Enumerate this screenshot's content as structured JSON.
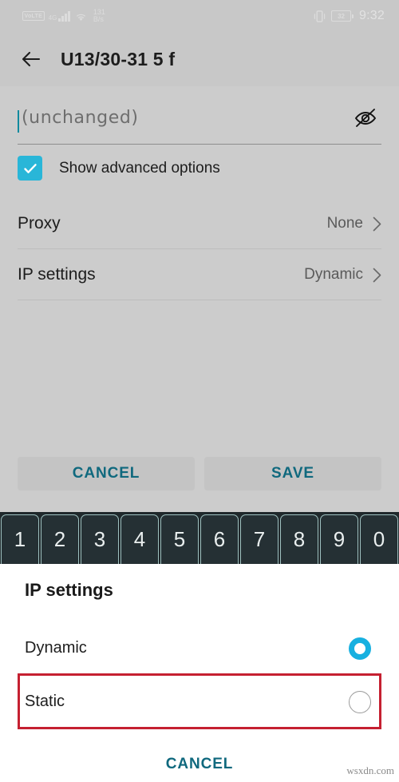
{
  "status_bar": {
    "volte_badge": "VoLTE",
    "network_type": "4G",
    "speed_value": "131",
    "speed_unit": "B/s",
    "battery_percent": "32",
    "time": "9:32"
  },
  "app_bar": {
    "title": "U13/30-31 5 f",
    "back_label": "Back"
  },
  "form": {
    "password_placeholder": "(unchanged)",
    "password_value": "",
    "advanced_checkbox_label": "Show advanced options",
    "rows": [
      {
        "title": "Proxy",
        "value": "None"
      },
      {
        "title": "IP settings",
        "value": "Dynamic"
      }
    ],
    "cancel_label": "CANCEL",
    "save_label": "SAVE"
  },
  "keyboard": {
    "keys": [
      "1",
      "2",
      "3",
      "4",
      "5",
      "6",
      "7",
      "8",
      "9",
      "0"
    ]
  },
  "dialog": {
    "title": "IP settings",
    "options": [
      {
        "label": "Dynamic",
        "selected": true
      },
      {
        "label": "Static",
        "selected": false
      }
    ],
    "cancel_label": "CANCEL"
  },
  "watermark": "wsxdn.com",
  "colors": {
    "accent_teal": "#10697e",
    "checkbox_teal": "#29b6d8",
    "radio_blue": "#17b0e0",
    "highlight_red": "#c52031",
    "page_background": "#cccccc",
    "keyboard_background": "#1f282b"
  }
}
